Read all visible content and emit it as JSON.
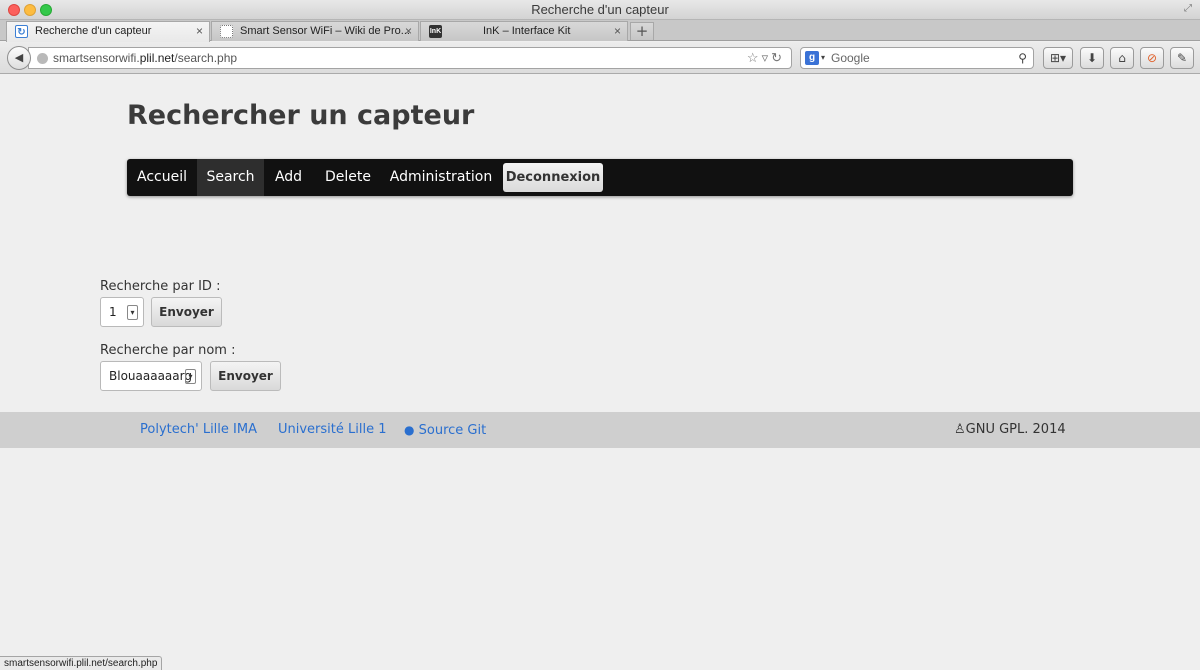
{
  "window": {
    "title": "Recherche d'un capteur"
  },
  "tabs": [
    {
      "label": "Recherche d'un capteur",
      "favicon": "refresh-icon",
      "active": true
    },
    {
      "label": "Smart Sensor WiFi – Wiki de Pro...",
      "favicon": "blank-page-icon",
      "active": false
    },
    {
      "label": "InK – Interface Kit",
      "favicon": "ink-logo-icon",
      "favicon_text": "InK",
      "active": false
    }
  ],
  "new_tab_label": "+",
  "close_glyph": "×",
  "address": {
    "host_prefix": "smartsensorwifi.",
    "host_bold": "plil.net",
    "path": "/search.php"
  },
  "search_engine": {
    "placeholder": "Google"
  },
  "page": {
    "title": "Rechercher un capteur",
    "nav": {
      "items": [
        "Accueil",
        "Search",
        "Add",
        "Delete",
        "Administration"
      ],
      "active": "Search",
      "logout_label": "Deconnexion"
    },
    "form_id": {
      "label": "Recherche par ID :",
      "selected": "1",
      "submit": "Envoyer"
    },
    "form_name": {
      "label": "Recherche par nom :",
      "selected": "Blouaaaaaarg",
      "submit": "Envoyer"
    }
  },
  "footer": {
    "links": [
      "Polytech' Lille IMA",
      "Université Lille 1",
      "Source Git"
    ],
    "license": "GNU GPL. 2014"
  },
  "statusbar": {
    "text": "smartsensorwifi.plil.net/search.php"
  },
  "colors": {
    "navbar": "#111111",
    "nav_active": "#2e2e2e",
    "link": "#2a6fcf",
    "footer": "#cfcfcf",
    "page_bg": "#efefef"
  }
}
